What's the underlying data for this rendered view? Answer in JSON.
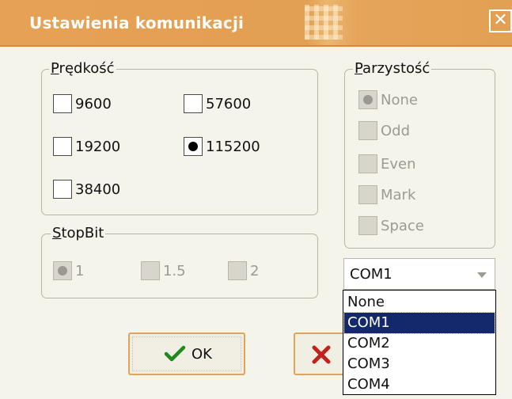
{
  "window": {
    "title": "Ustawienia komunikacji",
    "close_glyph": "✕"
  },
  "speed": {
    "legend_first": "P",
    "legend_rest": "rędkość",
    "options": [
      {
        "label": "9600",
        "selected": false
      },
      {
        "label": "57600",
        "selected": false
      },
      {
        "label": "19200",
        "selected": false
      },
      {
        "label": "115200",
        "selected": true
      },
      {
        "label": "38400",
        "selected": false
      }
    ]
  },
  "stopbit": {
    "legend_first": "S",
    "legend_rest": "topBit",
    "options": [
      {
        "label": "1",
        "selected": true
      },
      {
        "label": "1.5",
        "selected": false
      },
      {
        "label": "2",
        "selected": false
      }
    ]
  },
  "parity": {
    "legend_first": "P",
    "legend_rest": "arzystość",
    "options": [
      {
        "label": "None",
        "selected": true
      },
      {
        "label": "Odd",
        "selected": false
      },
      {
        "label": "Even",
        "selected": false
      },
      {
        "label": "Mark",
        "selected": false
      },
      {
        "label": "Space",
        "selected": false
      }
    ]
  },
  "port_combo": {
    "value": "COM1",
    "options": [
      "None",
      "COM1",
      "COM2",
      "COM3",
      "COM4"
    ],
    "highlighted": "COM1"
  },
  "buttons": {
    "ok_label": "OK",
    "cancel_icon": "x-icon",
    "ok_icon": "checkmark-icon"
  },
  "colors": {
    "title_bar": "#e2a052",
    "dropdown_highlight": "#13296c",
    "ok_check": "#1f8a1f",
    "cancel_x": "#c0231b"
  }
}
